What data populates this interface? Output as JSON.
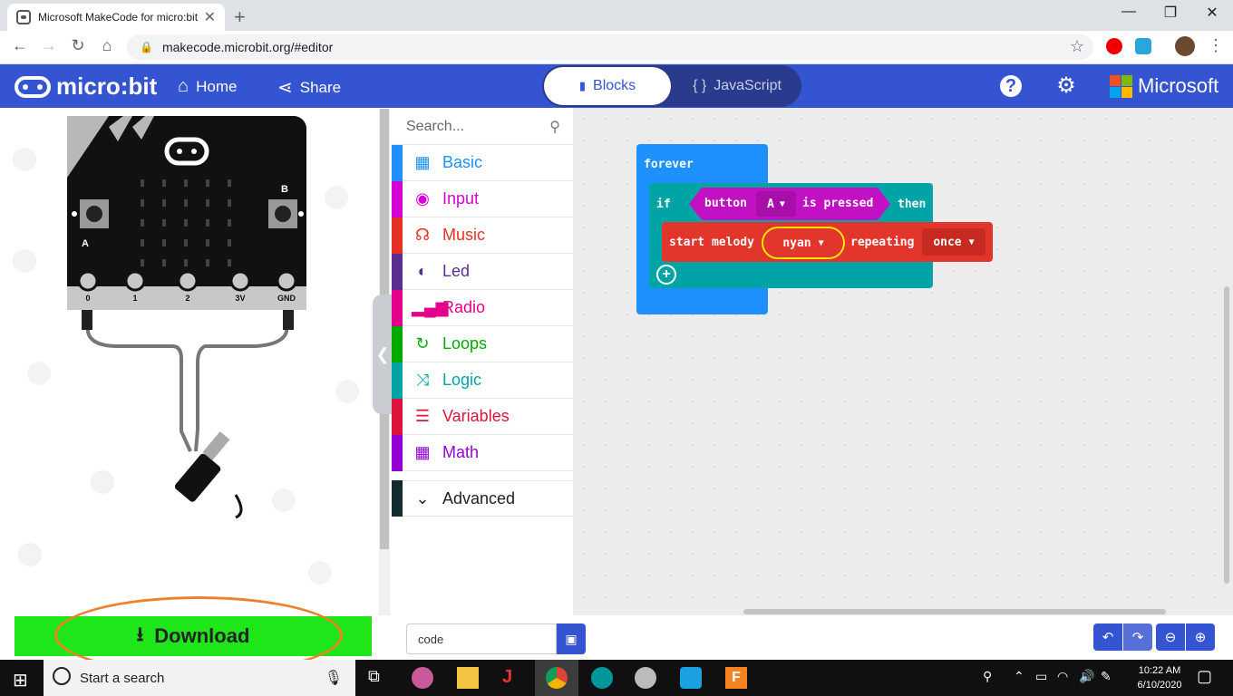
{
  "browser": {
    "tab_title": "Microsoft MakeCode for micro:bit",
    "url": "makecode.microbit.org/#editor",
    "new_tab": "+",
    "minimize": "—",
    "restore": "❐",
    "close": "✕"
  },
  "header": {
    "logo": "micro:bit",
    "home": "Home",
    "share": "Share",
    "blocks_tab": "Blocks",
    "javascript_tab": "JavaScript",
    "javascript_icon": "{ }",
    "microsoft": "Microsoft",
    "colors": {
      "bar": "#3454d1"
    }
  },
  "simulator": {
    "pins": [
      "0",
      "1",
      "2",
      "3V",
      "GND"
    ],
    "button_a": "A",
    "button_b": "B"
  },
  "toolbox": {
    "search_placeholder": "Search...",
    "categories": [
      {
        "label": "Basic",
        "color": "#1e90ff",
        "icon": "grid-icon"
      },
      {
        "label": "Input",
        "color": "#d400d4",
        "icon": "target-icon"
      },
      {
        "label": "Music",
        "color": "#e63022",
        "icon": "headphones-icon"
      },
      {
        "label": "Led",
        "color": "#5c2d91",
        "icon": "toggle-icon"
      },
      {
        "label": "Radio",
        "color": "#e3008c",
        "icon": "signal-icon"
      },
      {
        "label": "Loops",
        "color": "#00aa00",
        "icon": "refresh-icon"
      },
      {
        "label": "Logic",
        "color": "#00a4a6",
        "icon": "shuffle-icon"
      },
      {
        "label": "Variables",
        "color": "#dc143c",
        "icon": "lines-icon"
      },
      {
        "label": "Math",
        "color": "#9400d3",
        "icon": "calculator-icon"
      }
    ],
    "advanced": "Advanced"
  },
  "blocks": {
    "forever": "forever",
    "if": "if",
    "button": "button",
    "button_value": "A",
    "is_pressed": "is pressed",
    "then": "then",
    "start_melody": "start melody",
    "melody_value": "nyan",
    "repeating": "repeating",
    "repeat_value": "once"
  },
  "bottom": {
    "download": "Download",
    "project_name": "code"
  },
  "taskbar": {
    "search": "Start a search",
    "time": "10:22 AM",
    "date": "6/10/2020"
  }
}
